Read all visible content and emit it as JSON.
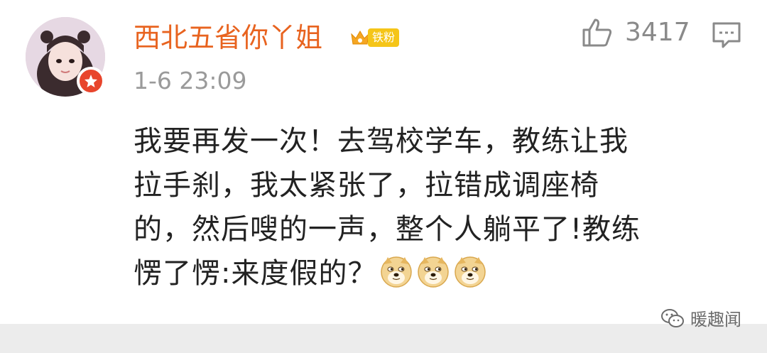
{
  "user": {
    "name": "西北五省你丫姐",
    "badge_label": "铁粉"
  },
  "like": {
    "count": "3417",
    "icon": "thumbs-up-icon"
  },
  "timestamp": "1-6 23:09",
  "post": {
    "lines": [
      "我要再发一次！去驾校学车，教练让我",
      "拉手刹，我太紧张了，拉错成调座椅",
      "的，然后嗖的一声，整个人躺平了!教练",
      "愣了愣:来度假的？"
    ],
    "emoji_count": 3
  },
  "watermark": {
    "text": "暖趣闻"
  },
  "colors": {
    "username": "#e8631f",
    "badge": "#f5c518",
    "avatar_badge": "#e8452c"
  }
}
